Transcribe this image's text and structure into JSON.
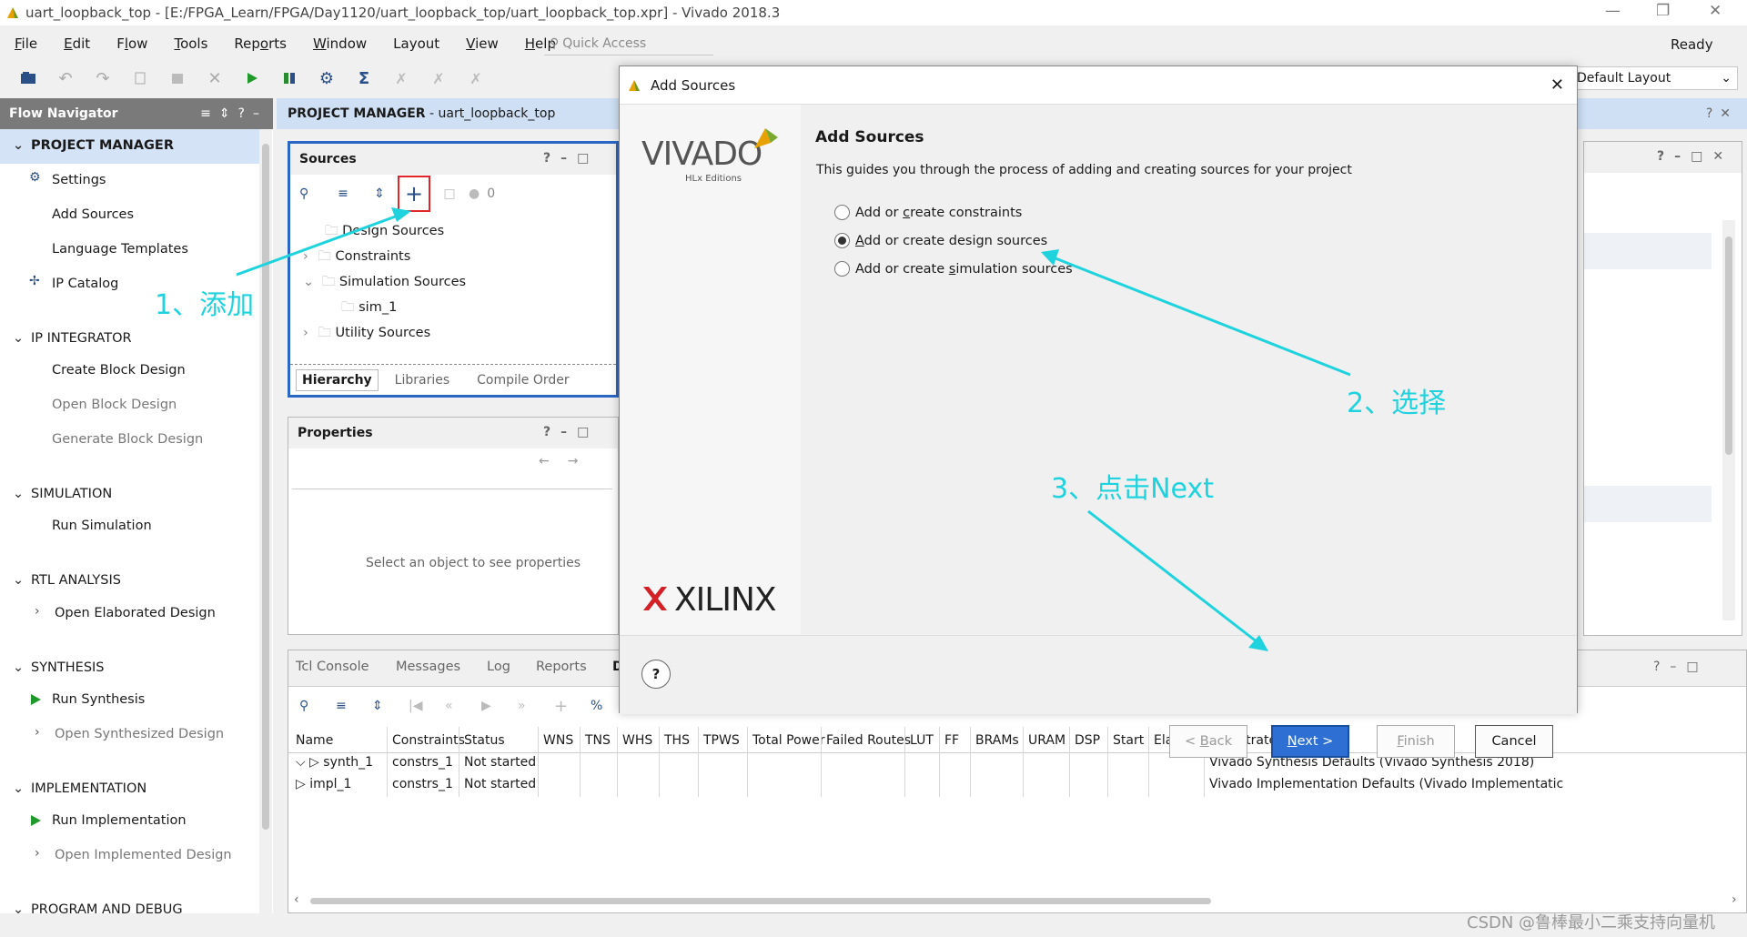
{
  "window": {
    "title": "uart_loopback_top - [E:/FPGA_Learn/FPGA/Day1120/uart_loopback_top/uart_loopback_top.xpr] - Vivado 2018.3"
  },
  "menu": {
    "items": [
      {
        "pre": "",
        "u": "F",
        "post": "ile"
      },
      {
        "pre": "",
        "u": "E",
        "post": "dit"
      },
      {
        "pre": "F",
        "u": "l",
        "post": "ow"
      },
      {
        "pre": "",
        "u": "T",
        "post": "ools"
      },
      {
        "pre": "Rep",
        "u": "o",
        "post": "rts"
      },
      {
        "pre": "",
        "u": "W",
        "post": "indow"
      },
      {
        "pre": "Layout",
        "u": "",
        "post": ""
      },
      {
        "pre": "",
        "u": "V",
        "post": "iew"
      },
      {
        "pre": "",
        "u": "H",
        "post": "elp"
      }
    ],
    "quick_access": "Quick Access",
    "status": "Ready"
  },
  "toolbar": {
    "layout_value": "Default Layout"
  },
  "flow_navigator": {
    "title": "Flow Navigator",
    "sections": {
      "project_manager": "PROJECT MANAGER",
      "settings": "Settings",
      "add_sources": "Add Sources",
      "language_templates": "Language Templates",
      "ip_catalog": "IP Catalog",
      "ip_integrator": "IP INTEGRATOR",
      "create_block": "Create Block Design",
      "open_block": "Open Block Design",
      "generate_block": "Generate Block Design",
      "simulation": "SIMULATION",
      "run_simulation": "Run Simulation",
      "rtl_analysis": "RTL ANALYSIS",
      "open_elaborated": "Open Elaborated Design",
      "synthesis": "SYNTHESIS",
      "run_synthesis": "Run Synthesis",
      "open_synthesized": "Open Synthesized Design",
      "implementation": "IMPLEMENTATION",
      "run_implementation": "Run Implementation",
      "open_implemented": "Open Implemented Design",
      "program_debug": "PROGRAM AND DEBUG"
    }
  },
  "project_manager": {
    "label": "PROJECT MANAGER",
    "project": " - uart_loopback_top"
  },
  "sources": {
    "title": "Sources",
    "count": "0",
    "tree": {
      "design": "Design Sources",
      "constraints": "Constraints",
      "simulation": "Simulation Sources",
      "sim1": "sim_1",
      "utility": "Utility Sources"
    },
    "tabs": {
      "hierarchy": "Hierarchy",
      "libraries": "Libraries",
      "compile_order": "Compile Order"
    }
  },
  "properties": {
    "title": "Properties",
    "empty": "Select an object to see properties"
  },
  "bottom": {
    "tabs": {
      "tcl": "Tcl Console",
      "messages": "Messages",
      "log": "Log",
      "reports": "Reports",
      "d": "D"
    },
    "columns": [
      "Name",
      "Constraints",
      "Status",
      "WNS",
      "TNS",
      "WHS",
      "THS",
      "TPWS",
      "Total Power",
      "Failed Routes",
      "LUT",
      "FF",
      "BRAMs",
      "URAM",
      "DSP",
      "Start",
      "Elapsed",
      "Run Strategy"
    ],
    "rows": [
      {
        "name": "synth_1",
        "constraints": "constrs_1",
        "status": "Not started",
        "strategy": "Vivado Synthesis Defaults (Vivado Synthesis 2018)"
      },
      {
        "name": "impl_1",
        "constraints": "constrs_1",
        "status": "Not started",
        "strategy": "Vivado Implementation Defaults (Vivado Implementatic"
      }
    ]
  },
  "dialog": {
    "title": "Add Sources",
    "heading": "Add Sources",
    "description": "This guides you through the process of adding and creating sources for your project",
    "options": [
      {
        "pre": "Add or ",
        "u": "c",
        "post": "reate constraints",
        "selected": false
      },
      {
        "pre": "",
        "u": "A",
        "post": "dd or create design sources",
        "selected": true
      },
      {
        "pre": "Add or create ",
        "u": "s",
        "post": "imulation sources",
        "selected": false
      }
    ],
    "brand": {
      "vivado": "VIVADO",
      "hlx": "HLx Editions",
      "xilinx": "XILINX"
    },
    "buttons": {
      "back": {
        "pre": "< ",
        "u": "B",
        "post": "ack"
      },
      "next": {
        "pre": "",
        "u": "N",
        "post": "ext >"
      },
      "finish": {
        "pre": "",
        "u": "F",
        "post": "inish"
      },
      "cancel": "Cancel"
    }
  },
  "annotations": {
    "step1": "1、添加",
    "step2": "2、选择",
    "step3": "3、点击Next"
  },
  "watermark": "CSDN @鲁棒最小二乘支持向量机",
  "colors": {
    "highlight_border": "#e0262b",
    "annotation": "#1fd3de",
    "primary_button": "#2d6fd3",
    "pm_header": "#cfe0f5"
  }
}
